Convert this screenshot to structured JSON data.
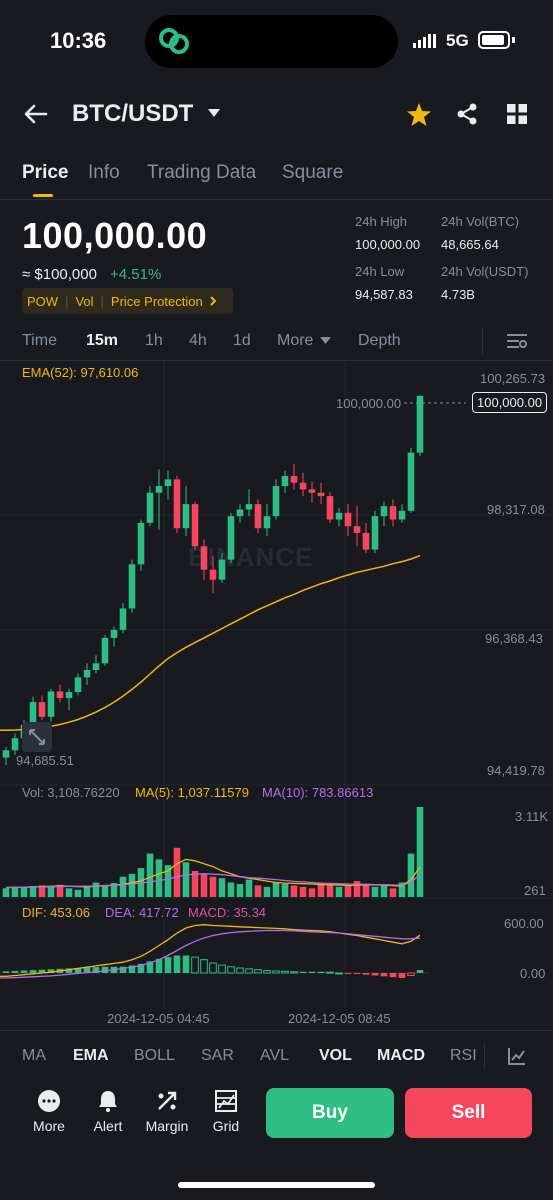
{
  "status": {
    "time": "10:36",
    "network": "5G"
  },
  "header": {
    "pair": "BTC/USDT",
    "icons": [
      "back-arrow-icon",
      "dropdown-caret-icon",
      "star-icon",
      "share-icon",
      "grid-icon"
    ]
  },
  "tabs": [
    "Price",
    "Info",
    "Trading Data",
    "Square"
  ],
  "ticker": {
    "last_price": "100,000.00",
    "usd_value": "≈ $100,000",
    "change": "+4.51%",
    "tags": [
      "POW",
      "Vol",
      "Price Protection"
    ],
    "high_label": "24h High",
    "high_value": "100,000.00",
    "vol_btc_label": "24h Vol(BTC)",
    "vol_btc_value": "48,665.64",
    "low_label": "24h Low",
    "low_value": "94,587.83",
    "vol_usdt_label": "24h Vol(USDT)",
    "vol_usdt_value": "4.73B"
  },
  "timeframes": [
    "Time",
    "15m",
    "1h",
    "4h",
    "1d",
    "More",
    "Depth"
  ],
  "main_chart": {
    "ema_label": "EMA(52): 97,610.06",
    "axis": [
      "100,265.73",
      "98,317.08",
      "96,368.43",
      "94,419.78"
    ],
    "last_price_tag": "100,000.00",
    "last_price_line_label": "100,000.00",
    "low_marker": "94,685.51",
    "watermark": "BINANCE"
  },
  "volume": {
    "vol_label": "Vol: 3,108.76220",
    "ma5_label": "MA(5): 1,037.11579",
    "ma10_label": "MA(10): 783.86613",
    "axis_top": "3.11K",
    "axis_bottom": "261"
  },
  "macd": {
    "dif_label": "DIF: 453.06",
    "dea_label": "DEA: 417.72",
    "macd_label": "MACD: 35.34",
    "axis_top": "600.00",
    "axis_mid": "0.00"
  },
  "time_axis": [
    "2024-12-05 04:45",
    "2024-12-05 08:45"
  ],
  "indicators": [
    "MA",
    "EMA",
    "BOLL",
    "SAR",
    "AVL",
    "VOL",
    "MACD",
    "RSI"
  ],
  "actions": {
    "more": "More",
    "alert": "Alert",
    "margin": "Margin",
    "grid": "Grid",
    "buy": "Buy",
    "sell": "Sell"
  },
  "colors": {
    "up": "#2ebd85",
    "down": "#f6465d",
    "accent": "#f0b90b",
    "ma10": "#b26ee8"
  },
  "chart_data": {
    "type": "candlestick",
    "interval": "15m",
    "price_axis": [
      "100,265.73",
      "98,317.08",
      "96,368.43",
      "94,419.78"
    ],
    "time_labels": [
      "2024-12-05 04:45",
      "2024-12-05 08:45"
    ],
    "candles": [
      {
        "o": 94590,
        "h": 94750,
        "l": 94480,
        "c": 94700
      },
      {
        "o": 94700,
        "h": 94950,
        "l": 94630,
        "c": 94880
      },
      {
        "o": 94880,
        "h": 95150,
        "l": 94800,
        "c": 95080
      },
      {
        "o": 95080,
        "h": 95500,
        "l": 95000,
        "c": 95420
      },
      {
        "o": 95420,
        "h": 95520,
        "l": 95150,
        "c": 95200
      },
      {
        "o": 95200,
        "h": 95620,
        "l": 95130,
        "c": 95580
      },
      {
        "o": 95580,
        "h": 95680,
        "l": 95420,
        "c": 95480
      },
      {
        "o": 95480,
        "h": 95620,
        "l": 95300,
        "c": 95570
      },
      {
        "o": 95570,
        "h": 95850,
        "l": 95520,
        "c": 95790
      },
      {
        "o": 95790,
        "h": 96000,
        "l": 95680,
        "c": 95900
      },
      {
        "o": 95900,
        "h": 96120,
        "l": 95850,
        "c": 96000
      },
      {
        "o": 96000,
        "h": 96420,
        "l": 95960,
        "c": 96380
      },
      {
        "o": 96380,
        "h": 96550,
        "l": 96250,
        "c": 96500
      },
      {
        "o": 96500,
        "h": 96900,
        "l": 96450,
        "c": 96820
      },
      {
        "o": 96820,
        "h": 97550,
        "l": 96760,
        "c": 97480
      },
      {
        "o": 97480,
        "h": 98150,
        "l": 97380,
        "c": 98100
      },
      {
        "o": 98100,
        "h": 98650,
        "l": 98050,
        "c": 98550
      },
      {
        "o": 98550,
        "h": 98900,
        "l": 98000,
        "c": 98650
      },
      {
        "o": 98650,
        "h": 98880,
        "l": 98450,
        "c": 98750
      },
      {
        "o": 98750,
        "h": 98800,
        "l": 97950,
        "c": 98020
      },
      {
        "o": 98020,
        "h": 98650,
        "l": 97900,
        "c": 98380
      },
      {
        "o": 98380,
        "h": 98420,
        "l": 97700,
        "c": 97750
      },
      {
        "o": 97750,
        "h": 97850,
        "l": 97250,
        "c": 97400
      },
      {
        "o": 97400,
        "h": 97600,
        "l": 97050,
        "c": 97250
      },
      {
        "o": 97250,
        "h": 97650,
        "l": 97200,
        "c": 97550
      },
      {
        "o": 97550,
        "h": 98250,
        "l": 97500,
        "c": 98200
      },
      {
        "o": 98200,
        "h": 98380,
        "l": 98100,
        "c": 98300
      },
      {
        "o": 98300,
        "h": 98600,
        "l": 98200,
        "c": 98380
      },
      {
        "o": 98380,
        "h": 98450,
        "l": 97950,
        "c": 98020
      },
      {
        "o": 98020,
        "h": 98380,
        "l": 97900,
        "c": 98200
      },
      {
        "o": 98200,
        "h": 98750,
        "l": 98150,
        "c": 98650
      },
      {
        "o": 98650,
        "h": 98880,
        "l": 98550,
        "c": 98800
      },
      {
        "o": 98800,
        "h": 98980,
        "l": 98600,
        "c": 98700
      },
      {
        "o": 98700,
        "h": 98850,
        "l": 98500,
        "c": 98600
      },
      {
        "o": 98600,
        "h": 98720,
        "l": 98400,
        "c": 98550
      },
      {
        "o": 98550,
        "h": 98700,
        "l": 98380,
        "c": 98500
      },
      {
        "o": 98500,
        "h": 98560,
        "l": 98100,
        "c": 98150
      },
      {
        "o": 98150,
        "h": 98320,
        "l": 98050,
        "c": 98250
      },
      {
        "o": 98250,
        "h": 98380,
        "l": 97900,
        "c": 98050
      },
      {
        "o": 98050,
        "h": 98350,
        "l": 97750,
        "c": 97950
      },
      {
        "o": 97950,
        "h": 98100,
        "l": 97650,
        "c": 97700
      },
      {
        "o": 97700,
        "h": 98280,
        "l": 97650,
        "c": 98200
      },
      {
        "o": 98200,
        "h": 98420,
        "l": 98050,
        "c": 98350
      },
      {
        "o": 98350,
        "h": 98450,
        "l": 98050,
        "c": 98150
      },
      {
        "o": 98150,
        "h": 98380,
        "l": 98100,
        "c": 98280
      },
      {
        "o": 98280,
        "h": 99220,
        "l": 98250,
        "c": 99150
      },
      {
        "o": 99150,
        "h": 100000,
        "l": 99100,
        "c": 100000
      }
    ],
    "ema52": [
      95000,
      95003,
      95010,
      95025,
      95040,
      95060,
      95085,
      95120,
      95160,
      95210,
      95270,
      95340,
      95420,
      95510,
      95610,
      95720,
      95840,
      95960,
      96070,
      96160,
      96240,
      96310,
      96380,
      96450,
      96520,
      96590,
      96660,
      96730,
      96800,
      96860,
      96920,
      96980,
      97030,
      97090,
      97140,
      97190,
      97230,
      97280,
      97320,
      97360,
      97390,
      97420,
      97450,
      97490,
      97520,
      97560,
      97610
    ],
    "volume": [
      300,
      350,
      320,
      380,
      400,
      350,
      420,
      300,
      250,
      380,
      500,
      420,
      480,
      700,
      800,
      1000,
      1500,
      1300,
      1100,
      1700,
      1200,
      900,
      800,
      700,
      650,
      500,
      450,
      600,
      400,
      350,
      500,
      450,
      400,
      350,
      300,
      500,
      450,
      350,
      400,
      550,
      450,
      350,
      400,
      300,
      500,
      1500,
      3108.76
    ],
    "ma5": [
      320,
      330,
      340,
      350,
      360,
      370,
      380,
      370,
      360,
      350,
      370,
      390,
      410,
      440,
      490,
      560,
      680,
      800,
      900,
      1150,
      1300,
      1250,
      1150,
      1050,
      900,
      800,
      700,
      650,
      600,
      550,
      500,
      480,
      470,
      460,
      450,
      430,
      420,
      410,
      400,
      410,
      420,
      420,
      410,
      390,
      380,
      600,
      1037.12
    ],
    "ma10": [
      330,
      335,
      340,
      345,
      350,
      355,
      360,
      365,
      370,
      372,
      380,
      390,
      400,
      420,
      450,
      480,
      520,
      570,
      620,
      700,
      760,
      790,
      800,
      790,
      770,
      740,
      700,
      670,
      650,
      630,
      600,
      570,
      540,
      520,
      500,
      480,
      470,
      460,
      450,
      445,
      440,
      430,
      420,
      415,
      410,
      500,
      783.87
    ],
    "dif": [
      -40,
      -30,
      -20,
      -10,
      0,
      10,
      25,
      40,
      55,
      70,
      85,
      100,
      115,
      130,
      160,
      200,
      260,
      330,
      400,
      480,
      540,
      570,
      580,
      570,
      565,
      560,
      555,
      550,
      545,
      540,
      535,
      530,
      520,
      515,
      510,
      505,
      495,
      480,
      465,
      450,
      430,
      410,
      390,
      370,
      350,
      380,
      453.06
    ],
    "dea": [
      -60,
      -55,
      -50,
      -45,
      -40,
      -35,
      -25,
      -15,
      -5,
      5,
      15,
      25,
      40,
      55,
      70,
      90,
      120,
      160,
      210,
      270,
      330,
      380,
      420,
      450,
      470,
      485,
      495,
      500,
      505,
      510,
      510,
      510,
      505,
      500,
      495,
      490,
      485,
      480,
      470,
      460,
      450,
      440,
      430,
      420,
      410,
      410,
      417.72
    ],
    "macd": [
      20,
      25,
      30,
      35,
      40,
      45,
      50,
      55,
      60,
      65,
      70,
      75,
      75,
      75,
      90,
      110,
      140,
      170,
      190,
      210,
      210,
      190,
      160,
      120,
      95,
      75,
      60,
      50,
      40,
      30,
      25,
      20,
      15,
      15,
      15,
      15,
      10,
      0,
      -5,
      -10,
      -20,
      -30,
      -40,
      -50,
      -60,
      -30,
      35.34
    ]
  }
}
